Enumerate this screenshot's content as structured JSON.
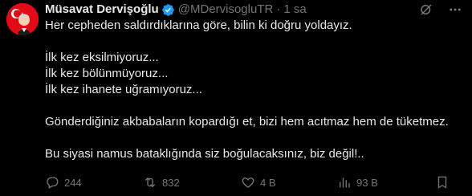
{
  "author": {
    "display_name": "Müsavat Dervişoğlu",
    "handle": "@MDervisogluTR",
    "separator": "·",
    "time": "1 sa",
    "verified": true
  },
  "tweet": {
    "lines": [
      "Her cepheden saldırdıklarına göre, bilin ki doğru yoldayız.",
      "",
      "İlk kez eksilmiyoruz...",
      "İlk kez bölünmüyoruz...",
      "İlk kez ihanete uğramıyoruz...",
      "",
      "Gönderdiğiniz akbabaların kopardığı et, bizi hem acıtmaz hem de tüketmez.",
      "",
      "Bu siyasi namus bataklığında siz boğulacaksınız, biz değil!.."
    ]
  },
  "stats": {
    "replies": "244",
    "retweets": "832",
    "likes": "4 B",
    "views": "93 B"
  },
  "colors": {
    "background": "#000000",
    "text": "#e7e9ea",
    "muted": "#71767b",
    "verified": "#1d9bf0",
    "avatar_bg": "#e30a17"
  },
  "icons": {
    "reply": "reply-icon",
    "retweet": "retweet-icon",
    "like": "heart-icon",
    "views": "views-icon",
    "bookmark": "bookmark-icon",
    "grok": "grok-icon",
    "more": "more-icon",
    "verified": "verified-badge-icon"
  }
}
